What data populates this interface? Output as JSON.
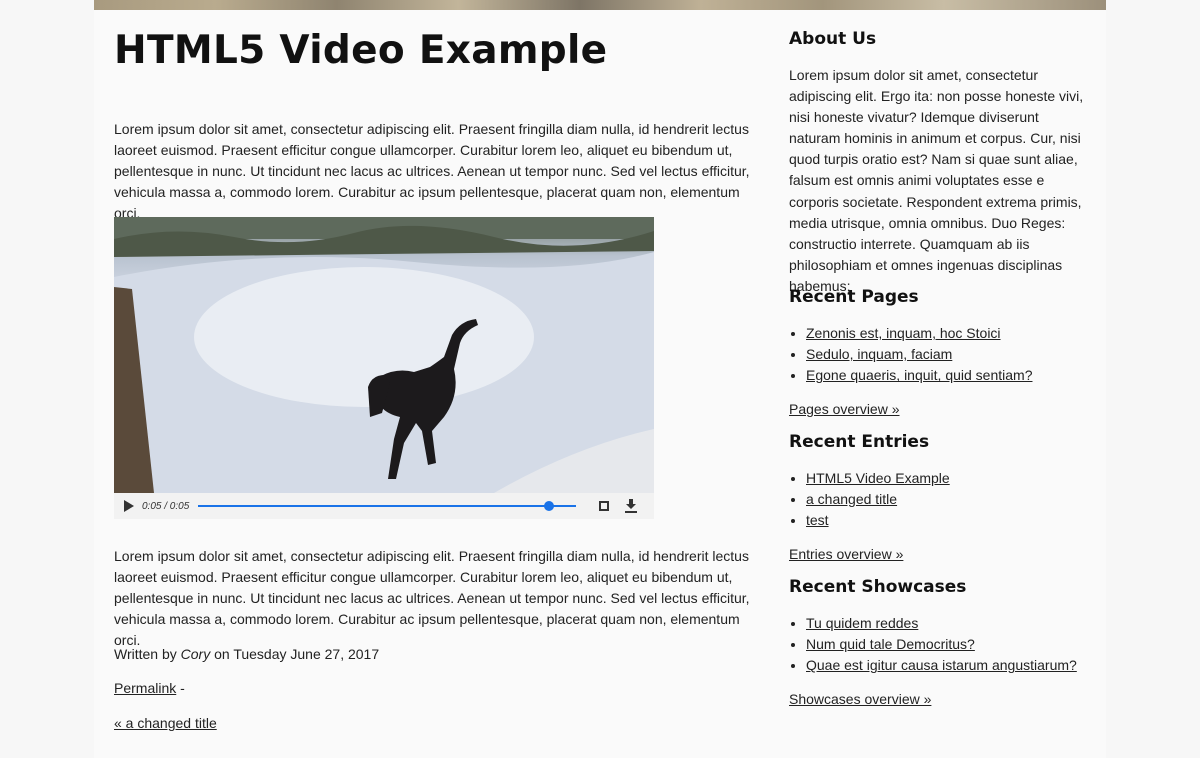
{
  "main": {
    "title": "HTML5 Video Example",
    "intro": "Lorem ipsum dolor sit amet, consectetur adipiscing elit. Praesent fringilla diam nulla, id hendrerit lectus laoreet euismod. Praesent efficitur congue ullamcorper. Curabitur lorem leo, aliquet eu bibendum ut, pellentesque in nunc. Ut tincidunt nec lacus ac ultrices. Aenean ut tempor nunc. Sed vel lectus efficitur, vehicula massa a, commodo lorem. Curabitur ac ipsum pellentesque, placerat quam non, elementum orci.",
    "video": {
      "time": "0:05 / 0:05",
      "progress": 0.94
    },
    "outro": "Lorem ipsum dolor sit amet, consectetur adipiscing elit. Praesent fringilla diam nulla, id hendrerit lectus laoreet euismod. Praesent efficitur congue ullamcorper. Curabitur lorem leo, aliquet eu bibendum ut, pellentesque in nunc. Ut tincidunt nec lacus ac ultrices. Aenean ut tempor nunc. Sed vel lectus efficitur, vehicula massa a, commodo lorem. Curabitur ac ipsum pellentesque, placerat quam non, elementum orci.",
    "byline": {
      "prefix": "Written by ",
      "author": "Cory",
      "suffix": " on Tuesday June 27, 2017"
    },
    "permalink": {
      "label": "Permalink",
      "separator": " -"
    },
    "previous": "« a changed title"
  },
  "sidebar": {
    "about_title": "About Us",
    "about_text": "Lorem ipsum dolor sit amet, consectetur adipiscing elit. Ergo ita: non posse honeste vivi, nisi honeste vivatur? Idemque diviserunt naturam hominis in animum et corpus. Cur, nisi quod turpis oratio est? Nam si quae sunt aliae, falsum est omnis animi voluptates esse e corporis societate. Respondent extrema primis, media utrisque, omnia omnibus. Duo Reges: constructio interrete. Quamquam ab iis philosophiam et omnes ingenuas disciplinas habemus;",
    "recent_pages": {
      "title": "Recent Pages",
      "items": [
        "Zenonis est, inquam, hoc Stoici",
        "Sedulo, inquam, faciam",
        "Egone quaeris, inquit, quid sentiam?"
      ],
      "overview": "Pages overview »"
    },
    "recent_entries": {
      "title": "Recent Entries",
      "items": [
        "HTML5 Video Example",
        "a changed title",
        "test"
      ],
      "overview": "Entries overview »"
    },
    "recent_showcases": {
      "title": "Recent Showcases",
      "items": [
        "Tu quidem reddes",
        "Num quid tale Democritus?",
        "Quae est igitur causa istarum angustiarum?"
      ],
      "overview": "Showcases overview »"
    }
  }
}
